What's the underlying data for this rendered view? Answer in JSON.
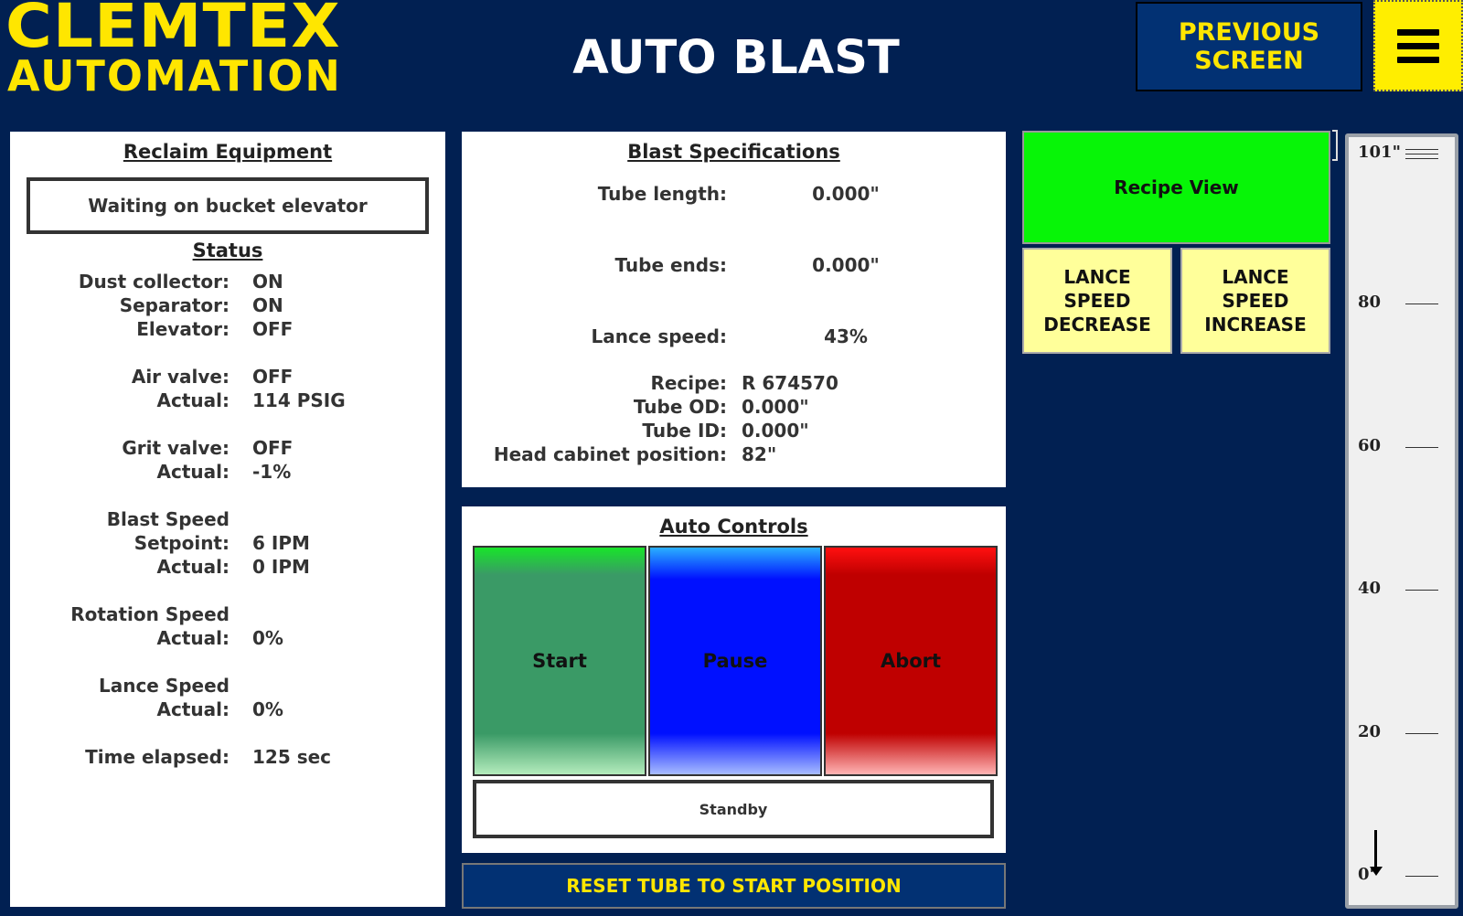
{
  "header": {
    "logo_line1": "CLEMTEX",
    "logo_line2": "AUTOMATION",
    "title": "AUTO BLAST",
    "previous_screen": "PREVIOUS\nSCREEN",
    "menu_icon": "hamburger-menu-icon"
  },
  "colors": {
    "background": "#012052",
    "brand_yellow": "#ffe600",
    "start_green": "#3a9a66",
    "pause_blue": "#0010ff",
    "abort_red": "#bf0000",
    "recipe_green": "#07f507",
    "lance_yellow": "#ffff9a"
  },
  "reclaim": {
    "title": "Reclaim Equipment",
    "message": "Waiting on bucket elevator",
    "status_title": "Status",
    "rows": [
      {
        "label": "Dust collector:",
        "value": "ON"
      },
      {
        "label": "Separator:",
        "value": "ON"
      },
      {
        "label": "Elevator:",
        "value": "OFF"
      },
      {
        "label": "Air valve:",
        "value": "OFF"
      },
      {
        "label": "Actual:",
        "value": "114 PSIG"
      },
      {
        "label": "Grit valve:",
        "value": "OFF"
      },
      {
        "label": "Actual:",
        "value": "-1%"
      },
      {
        "label": "Blast Speed",
        "value": ""
      },
      {
        "label": "Setpoint:",
        "value": "6 IPM"
      },
      {
        "label": "Actual:",
        "value": "0 IPM"
      },
      {
        "label": "Rotation Speed",
        "value": ""
      },
      {
        "label": "Actual:",
        "value": "0%"
      },
      {
        "label": "Lance Speed",
        "value": ""
      },
      {
        "label": "Actual:",
        "value": "0%"
      },
      {
        "label": "Time elapsed:",
        "value": "125 sec"
      }
    ]
  },
  "specs": {
    "title": "Blast Specifications",
    "tube_length_label": "Tube length:",
    "tube_length": "0.000\"",
    "tube_ends_label": "Tube ends:",
    "tube_ends": "0.000\"",
    "lance_speed_label": "Lance speed:",
    "lance_speed": "43%",
    "recipe_label": "Recipe:",
    "recipe": "R 674570",
    "tube_od_label": "Tube OD:",
    "tube_od": "0.000\"",
    "tube_id_label": "Tube ID:",
    "tube_id": "0.000\"",
    "head_cabinet_label": "Head cabinet position:",
    "head_cabinet": "82\""
  },
  "controls": {
    "title": "Auto Controls",
    "start": "Start",
    "pause": "Pause",
    "abort": "Abort",
    "state": "Standby"
  },
  "reset_button": "RESET TUBE TO START POSITION",
  "right": {
    "recipe_view": "Recipe View",
    "lance_decrease": "LANCE\nSPEED\nDECREASE",
    "lance_increase": "LANCE\nSPEED\nINCREASE"
  },
  "gauge": {
    "ticks": [
      "101\"",
      "80",
      "60",
      "40",
      "20",
      "0\""
    ],
    "tick_values": [
      101,
      80,
      60,
      40,
      20,
      0
    ],
    "max": 101,
    "position_value": 0
  }
}
